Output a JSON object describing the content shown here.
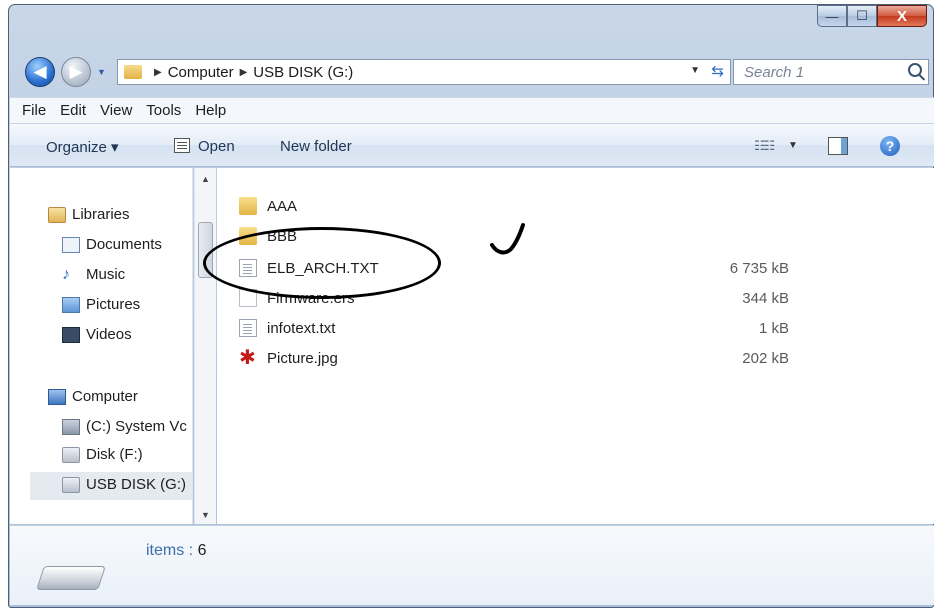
{
  "window": {
    "controls": {
      "minimize": "—",
      "maximize": "☐",
      "close": "X"
    }
  },
  "address": {
    "crumbs": [
      "Computer",
      "USB DISK (G:)"
    ],
    "search_placeholder": "Search 1"
  },
  "menu": [
    "File",
    "Edit",
    "View",
    "Tools",
    "Help"
  ],
  "toolbar": {
    "organize": "Organize ▾",
    "open": "Open",
    "new_folder": "New folder"
  },
  "nav_pane": {
    "libraries": "Libraries",
    "documents": "Documents",
    "music": "Music",
    "pictures": "Pictures",
    "videos": "Videos",
    "computer": "Computer",
    "drive_c": "(C:) System Vc",
    "drive_f": "Disk (F:)",
    "drive_g": "USB DISK (G:)"
  },
  "files": [
    {
      "name": "AAA",
      "size": "",
      "icon": "folder-icon"
    },
    {
      "name": "BBB",
      "size": "",
      "icon": "folder-icon"
    },
    {
      "name": "ELB_ARCH.TXT",
      "size": "6 735 kB",
      "icon": "text-file-icon"
    },
    {
      "name": "Firmware.ers",
      "size": "344 kB",
      "icon": "blank-file-icon"
    },
    {
      "name": "infotext.txt",
      "size": "1 kB",
      "icon": "text-file-icon"
    },
    {
      "name": "Picture.jpg",
      "size": "202 kB",
      "icon": "image-file-icon"
    }
  ],
  "details": {
    "items_label": "items",
    "items_count": "6"
  },
  "colors": {
    "frame": "#b9cbe2",
    "accent": "#3c6ea8",
    "selection": "#e5eaf1"
  }
}
